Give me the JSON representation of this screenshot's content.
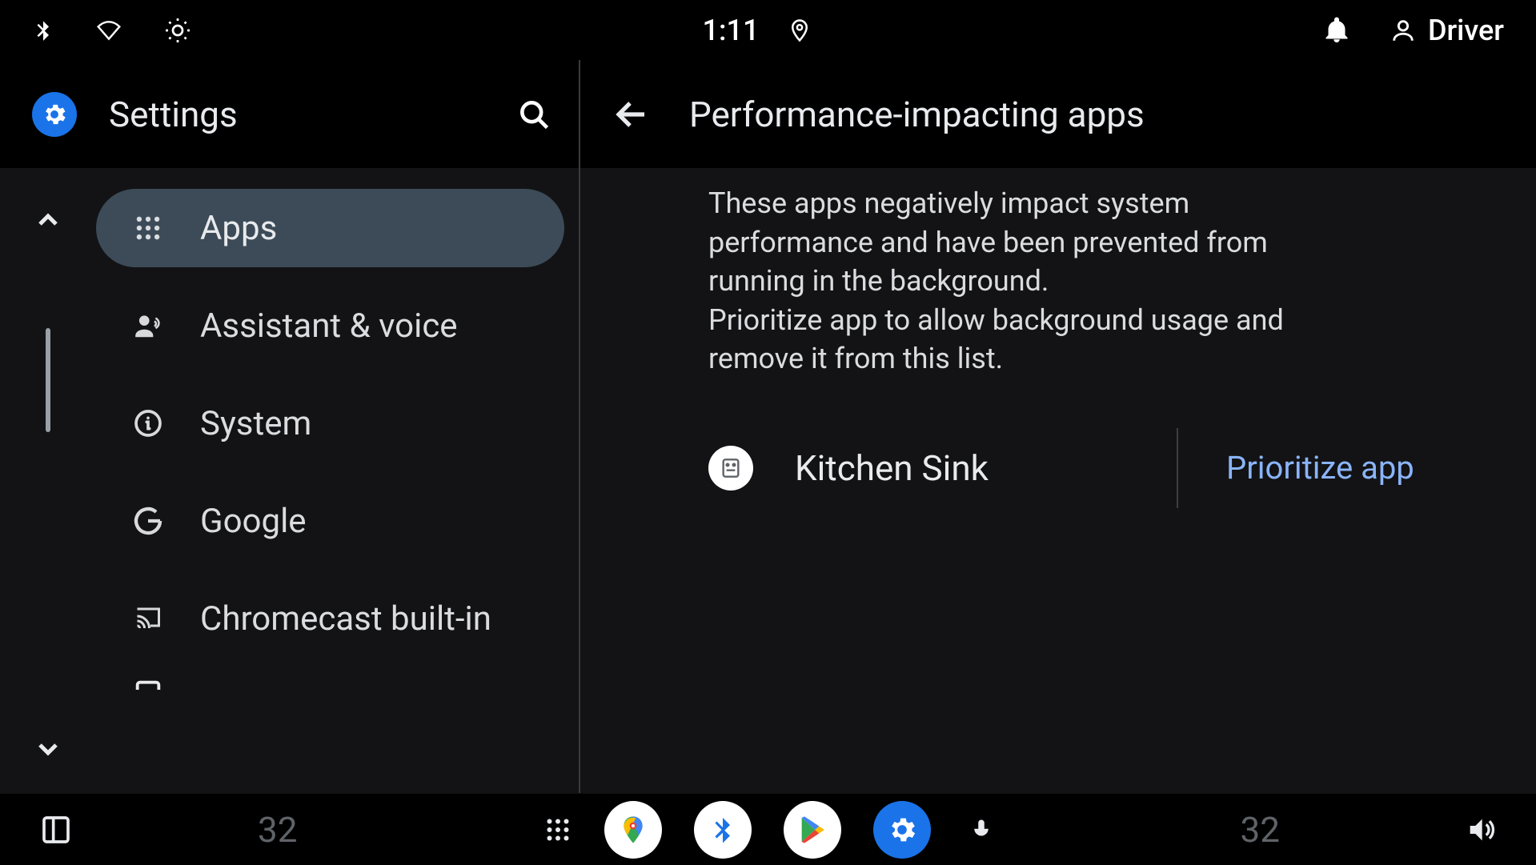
{
  "status": {
    "time": "1:11",
    "user_label": "Driver"
  },
  "left": {
    "title": "Settings",
    "items": [
      {
        "label": "Apps",
        "selected": true
      },
      {
        "label": "Assistant & voice",
        "selected": false
      },
      {
        "label": "System",
        "selected": false
      },
      {
        "label": "Google",
        "selected": false
      },
      {
        "label": "Chromecast built-in",
        "selected": false
      }
    ]
  },
  "right": {
    "title": "Performance-impacting apps",
    "description": "These apps negatively impact system performance and have been prevented from running in the background.\nPrioritize app to allow background usage and remove it from this list.",
    "apps": [
      {
        "name": "Kitchen Sink",
        "action_label": "Prioritize app"
      }
    ]
  },
  "bottom": {
    "temp_left": "32",
    "temp_right": "32"
  },
  "colors": {
    "accent": "#8ab4f8",
    "blue": "#1a73e8",
    "bg_panel": "#131315"
  }
}
